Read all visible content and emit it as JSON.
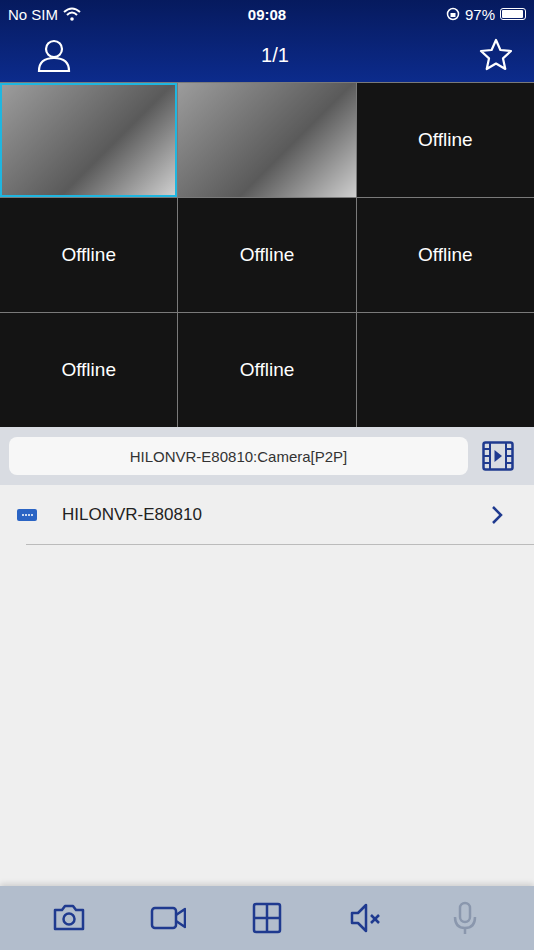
{
  "status_bar": {
    "carrier": "No SIM",
    "time": "09:08",
    "battery": "97%",
    "battery_level": 0.97
  },
  "nav": {
    "title": "1/1"
  },
  "channels": [
    {
      "kind": "video",
      "selected": true
    },
    {
      "kind": "video",
      "selected": false
    },
    {
      "kind": "offline",
      "label": "Offline",
      "selected": false
    },
    {
      "kind": "offline",
      "label": "Offline",
      "selected": false
    },
    {
      "kind": "offline",
      "label": "Offline",
      "selected": false
    },
    {
      "kind": "offline",
      "label": "Offline",
      "selected": false
    },
    {
      "kind": "offline",
      "label": "Offline",
      "selected": false
    },
    {
      "kind": "offline",
      "label": "Offline",
      "selected": false
    },
    {
      "kind": "empty",
      "selected": false
    }
  ],
  "current_channel": "HILONVR-E80810:Camera[P2P]",
  "devices": [
    {
      "name": "HILONVR-E80810"
    }
  ],
  "toolbar": [
    {
      "kind": "snapshot",
      "disabled": false
    },
    {
      "kind": "record",
      "disabled": false
    },
    {
      "kind": "layout",
      "disabled": false
    },
    {
      "kind": "mute",
      "disabled": false
    },
    {
      "kind": "talk",
      "disabled": true
    }
  ]
}
